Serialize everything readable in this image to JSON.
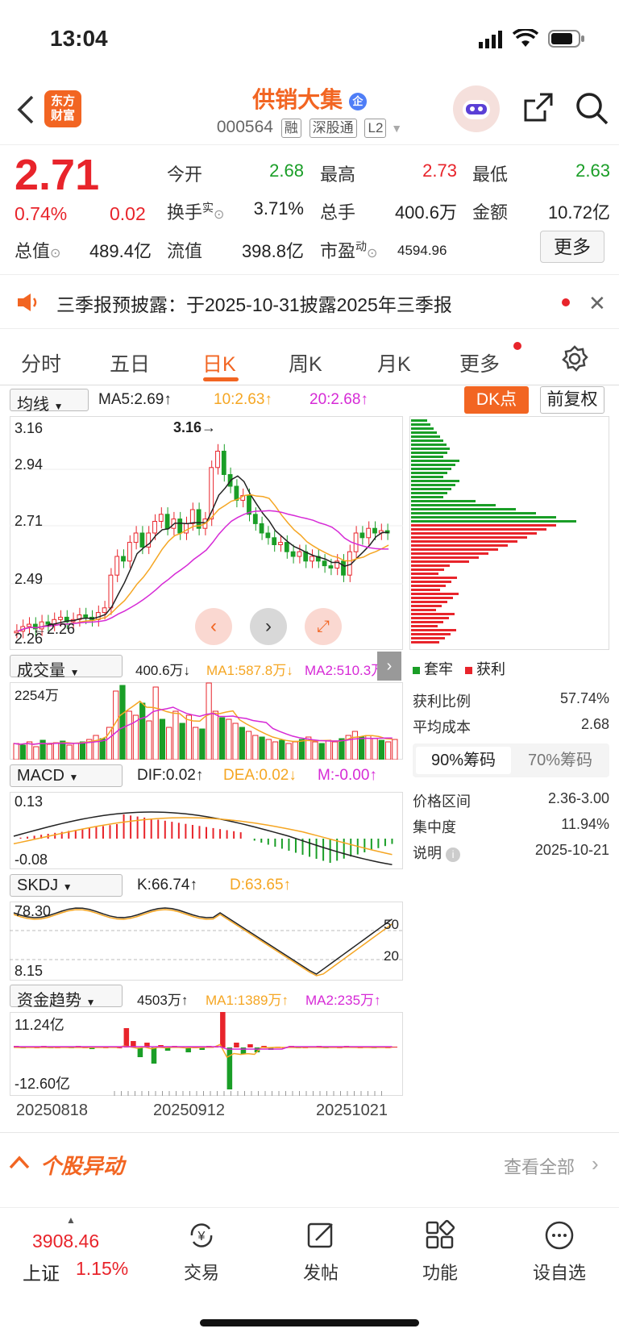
{
  "status": {
    "time": "13:04"
  },
  "header": {
    "logo_line1": "东方",
    "logo_line2": "财富",
    "name": "供销大集",
    "badge": "企",
    "code": "000564",
    "tags": [
      "融",
      "深股通",
      "L2"
    ]
  },
  "quote": {
    "price": "2.71",
    "change_pct": "0.74%",
    "change": "0.02",
    "open_label": "今开",
    "open": "2.68",
    "high_label": "最高",
    "high": "2.73",
    "low_label": "最低",
    "low": "2.63",
    "turnover_label": "换手",
    "turnover_sup": "实",
    "turnover": "3.71%",
    "volume_label": "总手",
    "volume": "400.6万",
    "amount_label": "金额",
    "amount": "10.72亿",
    "mktcap_label": "总值",
    "mktcap": "489.4亿",
    "float_label": "流值",
    "float": "398.8亿",
    "pe_label": "市盈",
    "pe_sup": "动",
    "pe": "4594.96",
    "more_label": "更多"
  },
  "notice": {
    "text": "三季报预披露：于2025-10-31披露2025年三季报"
  },
  "tabs": [
    "分时",
    "五日",
    "日K",
    "周K",
    "月K",
    "更多"
  ],
  "active_tab": "日K",
  "kline": {
    "indicator": "均线",
    "ma5": "MA5:2.69↑",
    "ma10": "10:2.63↑",
    "ma20": "20:2.68↑",
    "dk_label": "DK点",
    "adjust_label": "前复权",
    "y_labels": [
      "3.16",
      "2.94",
      "2.71",
      "2.49",
      "2.26"
    ],
    "high_mark": "3.16",
    "low_mark": "2.26",
    "colors": {
      "up": "#e8242b",
      "down": "#1a9e27",
      "ma5": "#222222",
      "ma10": "#f5a623",
      "ma20": "#d62ad6"
    }
  },
  "chips": {
    "legend_trap": "套牢",
    "legend_profit": "获利",
    "profit_ratio_label": "获利比例",
    "profit_ratio": "57.74%",
    "avg_cost_label": "平均成本",
    "avg_cost": "2.68",
    "tab_90": "90%筹码",
    "tab_70": "70%筹码",
    "range_label": "价格区间",
    "range": "2.36-3.00",
    "concentration_label": "集中度",
    "concentration": "11.94%",
    "note_label": "说明",
    "note_date": "2025-10-21"
  },
  "volume": {
    "indicator": "成交量",
    "value": "400.6万↓",
    "ma1": "MA1:587.8万↓",
    "ma2": "MA2:510.3万",
    "max_label": "2254万"
  },
  "macd": {
    "indicator": "MACD",
    "dif": "DIF:0.02↑",
    "dea": "DEA:0.02↓",
    "m": "M:-0.00↑",
    "top": "0.13",
    "bottom": "-0.08"
  },
  "skdj": {
    "indicator": "SKDJ",
    "k": "K:66.74↑",
    "d": "D:63.65↑",
    "top": "78.30",
    "bottom": "8.15",
    "line50": "50",
    "line20": "20"
  },
  "fund": {
    "indicator": "资金趋势",
    "value": "4503万↑",
    "ma1": "MA1:1389万↑",
    "ma2": "MA2:235万↑",
    "top": "11.24亿",
    "bottom": "-12.60亿"
  },
  "dates": [
    "20250818",
    "20250912",
    "20251021"
  ],
  "movement": {
    "title": "个股异动",
    "view_all": "查看全部"
  },
  "bottom": {
    "index_value": "3908.46",
    "index_name": "上证",
    "index_pct": "1.15%",
    "items": [
      "交易",
      "发帖",
      "功能",
      "设自选"
    ]
  }
}
